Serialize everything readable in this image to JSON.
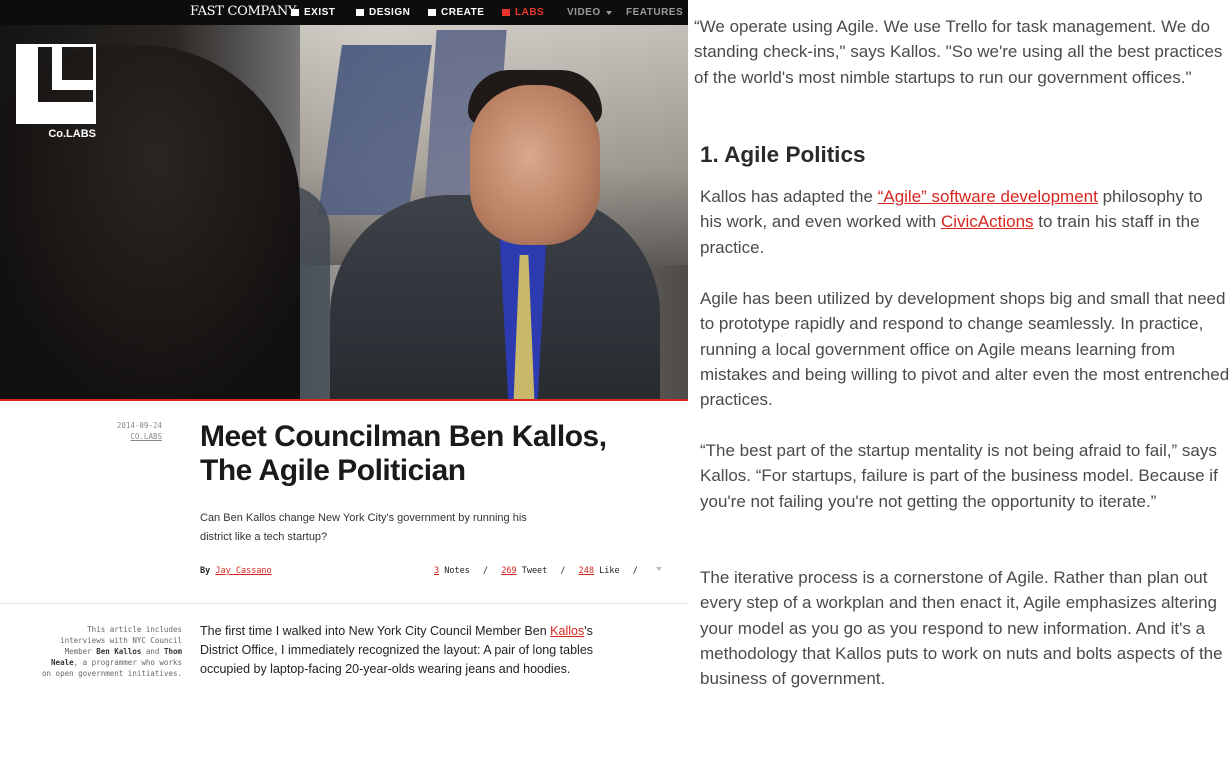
{
  "navbar": {
    "brand": "FAST COMPANY",
    "items": [
      {
        "label": "EXIST",
        "icon": "exist-icon"
      },
      {
        "label": "DESIGN",
        "icon": "design-icon"
      },
      {
        "label": "CREATE",
        "icon": "create-icon"
      },
      {
        "label": "LABS",
        "icon": "labs-icon",
        "active": true
      },
      {
        "label": "VIDEO"
      },
      {
        "label": "FEATURES"
      }
    ]
  },
  "logo": {
    "label": "Co.LABS"
  },
  "article": {
    "date": "2014-09-24",
    "category": "CO.LABS",
    "title_line1": "Meet Councilman Ben Kallos,",
    "title_line2": "The Agile Politician",
    "dek": "Can Ben Kallos change New York City's government by running his district like a tech startup?",
    "byline_prefix": "By",
    "author": "Jay Cassano",
    "social": {
      "notes_count": "3",
      "notes_label": "Notes",
      "tweet_count": "269",
      "tweet_label": "Tweet",
      "like_count": "248",
      "like_label": "Like",
      "sep": "/"
    },
    "sidenote_pre": "This article includes interviews with NYC Council Member",
    "sidenote_name1": "Ben Kallos",
    "sidenote_and": "and",
    "sidenote_name2": "Thom Neale",
    "sidenote_post": ", a programmer who works on open government initiatives.",
    "body_pre": "The first time I walked into New York City Council Member Ben",
    "body_link": "Kallos",
    "body_post": "'s District Office, I immediately recognized the layout: A pair of long tables occupied by laptop-facing 20-year-olds wearing jeans and hoodies."
  },
  "right": {
    "quote1": "“We operate using Agile. We use Trello for task management. We do standing check-ins,\" says Kallos. \"So we're using all the best practices of the world's most nimble startups to run our government offices.\"",
    "heading": "1. Agile Politics",
    "p1_pre": "Kallos has adapted the ",
    "p1_link1": "“Agile” software development",
    "p1_mid": " philosophy to his work, and even worked with ",
    "p1_link2": "CivicActions",
    "p1_post": " to train his staff in the practice.",
    "p2": "Agile has been utilized by development shops big and small that need to prototype rapidly and respond to change seamlessly. In practice, running a local government office on Agile means learning from mistakes and being willing to pivot and alter even the most entrenched practices.",
    "p3": "“The best part of the startup mentality is not being afraid to fail,” says Kallos. “For startups, failure is part of the business model. Because if you're not failing you're not getting the opportunity to iterate.”",
    "p4": "The iterative process is a cornerstone of Agile. Rather than plan out every step of a workplan and then enact it, Agile emphasizes altering your model as you go as you respond to new information. And it's a methodology that Kallos puts to work on nuts and bolts aspects of the business of government."
  },
  "colors": {
    "accent": "#d8261e",
    "navbar": "#0d0d0d"
  }
}
